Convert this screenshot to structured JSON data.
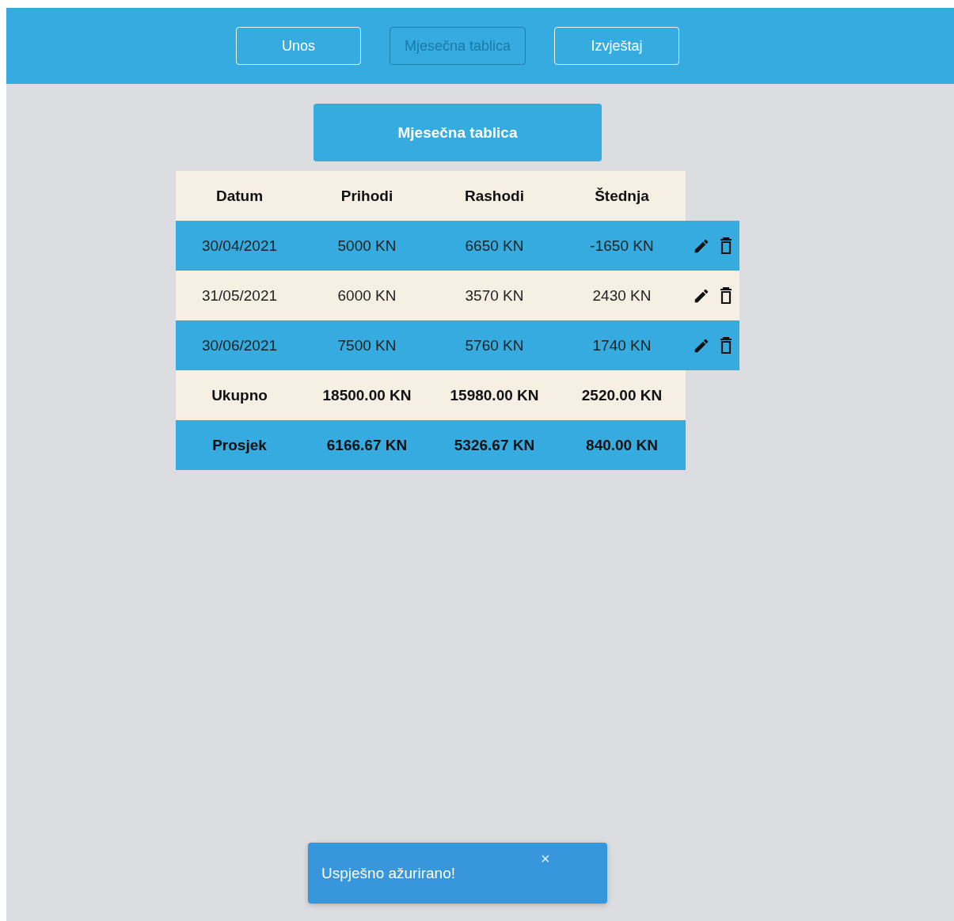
{
  "nav": [
    {
      "label": "Unos",
      "selected": false
    },
    {
      "label": "Mjesečna tablica",
      "selected": true
    },
    {
      "label": "Izvještaj",
      "selected": false
    }
  ],
  "page_title": "Mjesečna tablica",
  "table": {
    "columns": [
      "Datum",
      "Prihodi",
      "Rashodi",
      "Štednja"
    ],
    "rows": [
      {
        "kind": "entry",
        "cells": [
          "30/04/2021",
          "5000 KN",
          "6650 KN",
          "-1650 KN"
        ]
      },
      {
        "kind": "entry",
        "cells": [
          "31/05/2021",
          "6000 KN",
          "3570 KN",
          "2430 KN"
        ]
      },
      {
        "kind": "entry",
        "cells": [
          "30/06/2021",
          "7500 KN",
          "5760 KN",
          "1740 KN"
        ]
      },
      {
        "kind": "summary",
        "cells": [
          "Ukupno",
          "18500.00 KN",
          "15980.00 KN",
          "2520.00 KN"
        ]
      },
      {
        "kind": "summary",
        "cells": [
          "Prosjek",
          "6166.67 KN",
          "5326.67 KN",
          "840.00 KN"
        ]
      }
    ]
  },
  "toast": {
    "message": "Uspješno ažurirano!",
    "close": "×"
  }
}
